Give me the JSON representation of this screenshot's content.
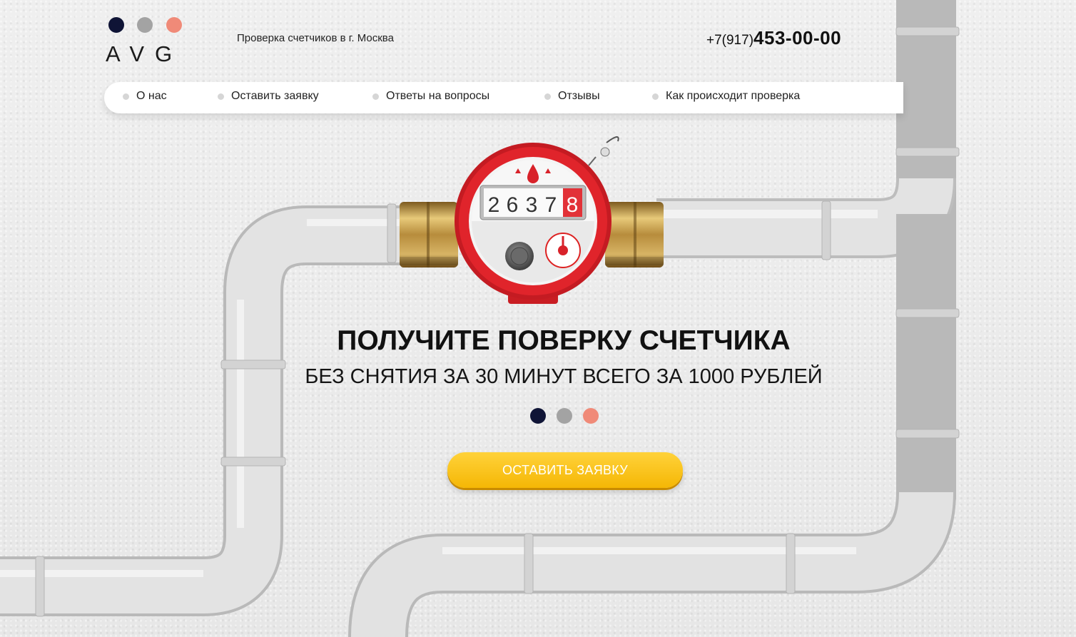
{
  "brand": {
    "logo_text": "AVG",
    "tagline": "Проверка счетчиков в г. Москва",
    "colors": {
      "navy": "#0f1436",
      "gray": "#a3a3a3",
      "salmon": "#f08a78",
      "cta": "#fbc51a",
      "meter_red": "#e0242b"
    }
  },
  "header": {
    "phone_prefix": "+7(917)",
    "phone_main": "453-00-00"
  },
  "nav": {
    "items": [
      {
        "label": "О нас"
      },
      {
        "label": "Оставить заявку"
      },
      {
        "label": "Ответы на вопросы"
      },
      {
        "label": "Отзывы"
      },
      {
        "label": "Как происходит проверка"
      }
    ]
  },
  "hero": {
    "title": "ПОЛУЧИТЕ ПОВЕРКУ СЧЕТЧИКА",
    "subtitle": "БЕЗ СНЯТИЯ ЗА 30 МИНУТ ВСЕГО ЗА 1000 РУБЛЕЙ",
    "meter_digits": [
      "2",
      "6",
      "3",
      "7",
      "8"
    ],
    "cta_label": "ОСТАВИТЬ ЗАЯВКУ"
  },
  "icons": [
    "water-drop-icon",
    "pipe-illustration",
    "water-meter-illustration"
  ]
}
